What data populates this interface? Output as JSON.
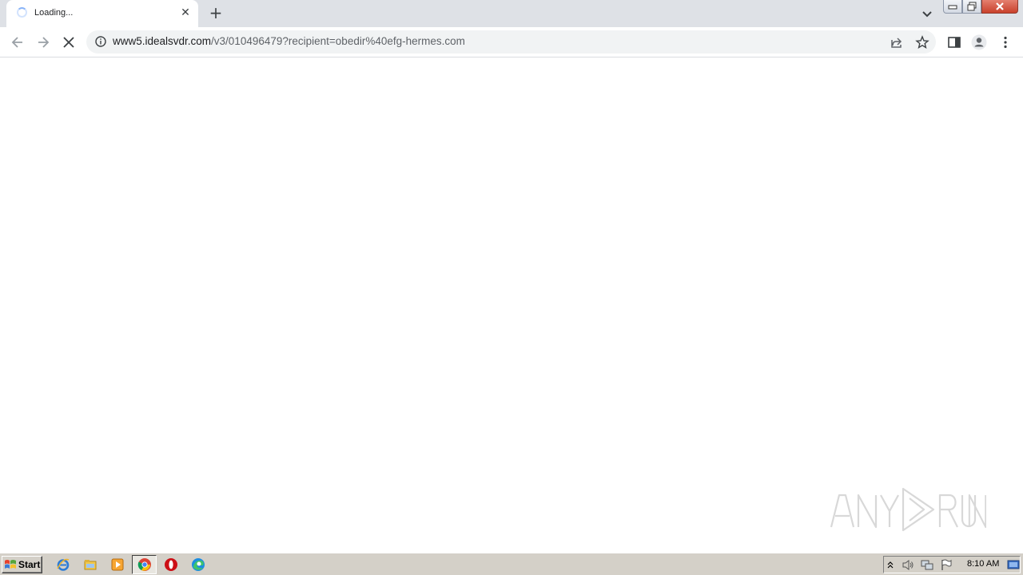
{
  "browser": {
    "tab": {
      "title": "Loading..."
    },
    "address_bar": {
      "url_host": "www5.idealsvdr.com",
      "url_path": "/v3/010496479?recipient=obedir%40efg-hermes.com"
    }
  },
  "watermark": {
    "text": "ANY RUN"
  },
  "taskbar": {
    "start_label": "Start",
    "clock": "8:10 AM",
    "pinned": [
      "internet-explorer-icon",
      "file-explorer-icon",
      "media-player-icon",
      "chrome-icon",
      "opera-icon",
      "edge-icon"
    ]
  },
  "colors": {
    "tabstrip": "#dee1e6",
    "omnibox": "#f1f3f4",
    "taskbar": "#d4d0c8",
    "close_button": "#c9412c"
  }
}
